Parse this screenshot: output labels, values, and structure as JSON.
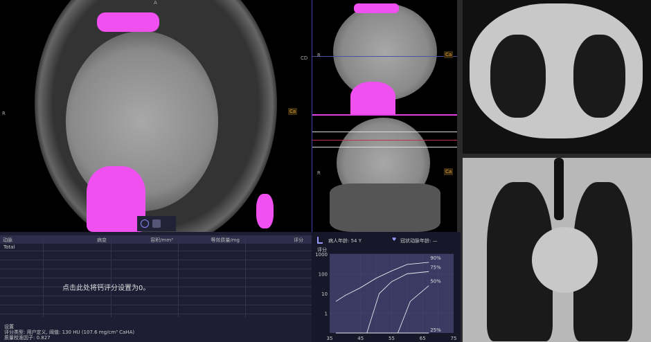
{
  "viewer": {
    "axial": {
      "label_top": "A",
      "label_left": "R",
      "tag": "Ca"
    },
    "sagittal": {
      "label_r_top": "R",
      "label_r_bottom": "R",
      "tag_top": "Ca",
      "tag_bottom": "Ca",
      "label_cd": "CD"
    }
  },
  "table": {
    "headers": [
      "动脉",
      "病变",
      "容积/mm³",
      "等效质量/mg",
      "评分"
    ],
    "rows": [
      {
        "artery": "Total"
      }
    ],
    "message": "点击此处将钙评分设置为0。",
    "settings_title": "设置",
    "settings_line1": "评分类型: 用户定义, 阈值: 130 HU (107.6 mg/cm³ CaHA)",
    "settings_line2": "质量校准因子: 0.827"
  },
  "chart_header": {
    "patient_age": "病人年龄: 54 Y",
    "coronary_age": "冠状动脉年龄: —"
  },
  "chart_data": {
    "type": "line",
    "ylabel": "评分",
    "yscale": "log",
    "ylim": [
      0.1,
      1000
    ],
    "xlim": [
      35,
      75
    ],
    "yticks": [
      "1000",
      "100",
      "10",
      "1"
    ],
    "ytick_values": [
      1000,
      100,
      10,
      1
    ],
    "xticks": [
      "35",
      "45",
      "55",
      "65",
      "75"
    ],
    "xtick_values": [
      35,
      45,
      55,
      65,
      75
    ],
    "series": [
      {
        "name": "90%",
        "x": [
          37,
          40,
          45,
          50,
          55,
          60,
          67
        ],
        "y": [
          4,
          8,
          20,
          60,
          140,
          300,
          380
        ]
      },
      {
        "name": "75%",
        "x": [
          47,
          51,
          55,
          60,
          67
        ],
        "y": [
          0.1,
          10,
          40,
          100,
          130
        ]
      },
      {
        "name": "50%",
        "x": [
          57,
          61,
          67
        ],
        "y": [
          0.1,
          4,
          25
        ]
      },
      {
        "name": "25%",
        "x": [
          37,
          67
        ],
        "y": [
          0.1,
          0.1
        ]
      }
    ]
  }
}
